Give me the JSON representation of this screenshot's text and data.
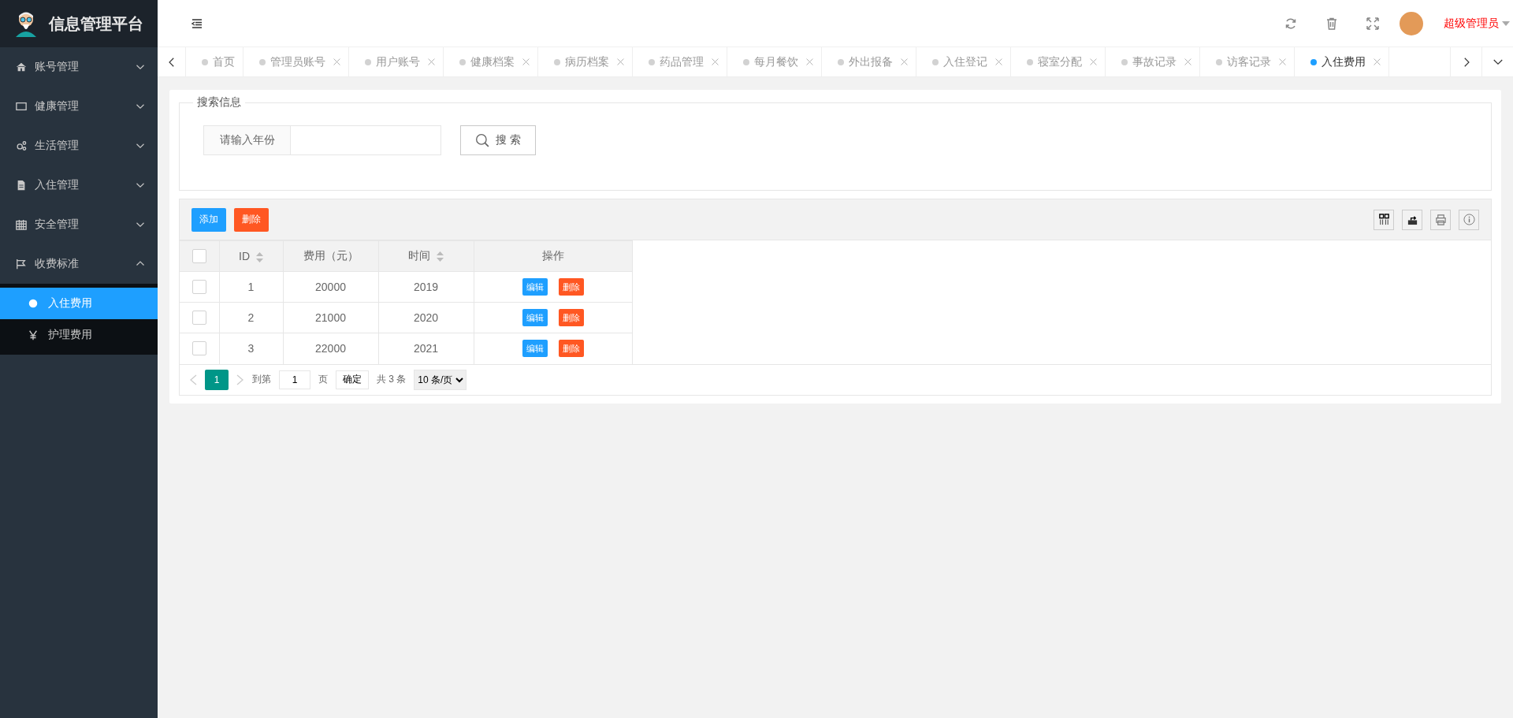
{
  "sidebar": {
    "title": "信息管理平台",
    "menu": [
      {
        "label": "账号管理",
        "expanded": false
      },
      {
        "label": "健康管理",
        "expanded": false
      },
      {
        "label": "生活管理",
        "expanded": false
      },
      {
        "label": "入住管理",
        "expanded": false
      },
      {
        "label": "安全管理",
        "expanded": false
      },
      {
        "label": "收费标准",
        "expanded": true,
        "children": [
          {
            "label": "入住费用",
            "selected": true
          },
          {
            "label": "护理费用",
            "selected": false
          }
        ]
      }
    ]
  },
  "header": {
    "user": "超级管理员"
  },
  "tabs": [
    {
      "label": "首页",
      "selected": false,
      "closable": false
    },
    {
      "label": "管理员账号",
      "selected": false,
      "closable": true
    },
    {
      "label": "用户账号",
      "selected": false,
      "closable": true
    },
    {
      "label": "健康档案",
      "selected": false,
      "closable": true
    },
    {
      "label": "病历档案",
      "selected": false,
      "closable": true
    },
    {
      "label": "药品管理",
      "selected": false,
      "closable": true
    },
    {
      "label": "每月餐饮",
      "selected": false,
      "closable": true
    },
    {
      "label": "外出报备",
      "selected": false,
      "closable": true
    },
    {
      "label": "入住登记",
      "selected": false,
      "closable": true
    },
    {
      "label": "寝室分配",
      "selected": false,
      "closable": true
    },
    {
      "label": "事故记录",
      "selected": false,
      "closable": true
    },
    {
      "label": "访客记录",
      "selected": false,
      "closable": true
    },
    {
      "label": "入住费用",
      "selected": true,
      "closable": true
    }
  ],
  "search": {
    "legend": "搜索信息",
    "label": "请输入年份",
    "button": "搜 索"
  },
  "toolbar": {
    "buttons": [
      {
        "label": "添加",
        "kind": "primary"
      },
      {
        "label": "删除",
        "kind": "danger"
      }
    ]
  },
  "table": {
    "header_checked": false,
    "columns": [
      {
        "label": "ID",
        "sortable": true
      },
      {
        "label": "费用（元）",
        "sortable": false
      },
      {
        "label": "时间",
        "sortable": true
      },
      {
        "label": "操作",
        "sortable": false
      }
    ],
    "rows": [
      {
        "checked": false,
        "id": "1",
        "fee": "20000",
        "year": "2019",
        "actions": [
          {
            "label": "编辑",
            "kind": "primary"
          },
          {
            "label": "删除",
            "kind": "danger"
          }
        ]
      },
      {
        "checked": false,
        "id": "2",
        "fee": "21000",
        "year": "2020",
        "actions": [
          {
            "label": "编辑",
            "kind": "primary"
          },
          {
            "label": "删除",
            "kind": "danger"
          }
        ]
      },
      {
        "checked": false,
        "id": "3",
        "fee": "22000",
        "year": "2021",
        "actions": [
          {
            "label": "编辑",
            "kind": "primary"
          },
          {
            "label": "删除",
            "kind": "danger"
          }
        ]
      }
    ]
  },
  "pagination": {
    "pages": [
      {
        "label": "1",
        "selected": true
      }
    ],
    "goto_label": "到第",
    "page_value": "1",
    "page_suffix": "页",
    "confirm": "确定",
    "total": "共 3 条",
    "page_size": "10 条/页"
  }
}
